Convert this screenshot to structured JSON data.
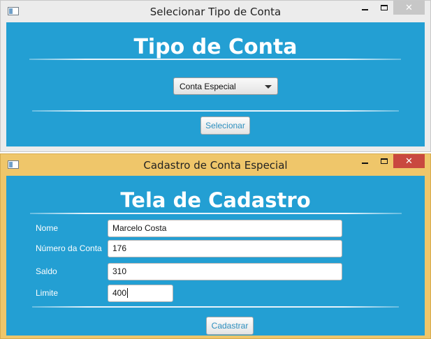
{
  "tipo_window": {
    "title": "Selecionar Tipo de Conta",
    "heading": "Tipo de Conta",
    "account_type_select": {
      "selected": "Conta Especial"
    },
    "select_button_label": "Selecionar"
  },
  "cadastro_window": {
    "title": "Cadastro de Conta Especial",
    "heading": "Tela de Cadastro",
    "fields": {
      "nome": {
        "label": "Nome",
        "value": "Marcelo Costa"
      },
      "numero": {
        "label": "Número da Conta",
        "value": "176"
      },
      "saldo": {
        "label": "Saldo",
        "value": "310"
      },
      "limite": {
        "label": "Limite",
        "value": "400"
      }
    },
    "register_button_label": "Cadastrar"
  },
  "window_controls": {
    "minimize": "minimize-icon",
    "maximize": "maximize-icon",
    "close": "close-icon"
  },
  "colors": {
    "panel_bg": "#239fd3",
    "active_frame": "#efc66a",
    "close_active": "#c9483f",
    "button_text": "#2d8fbf"
  }
}
